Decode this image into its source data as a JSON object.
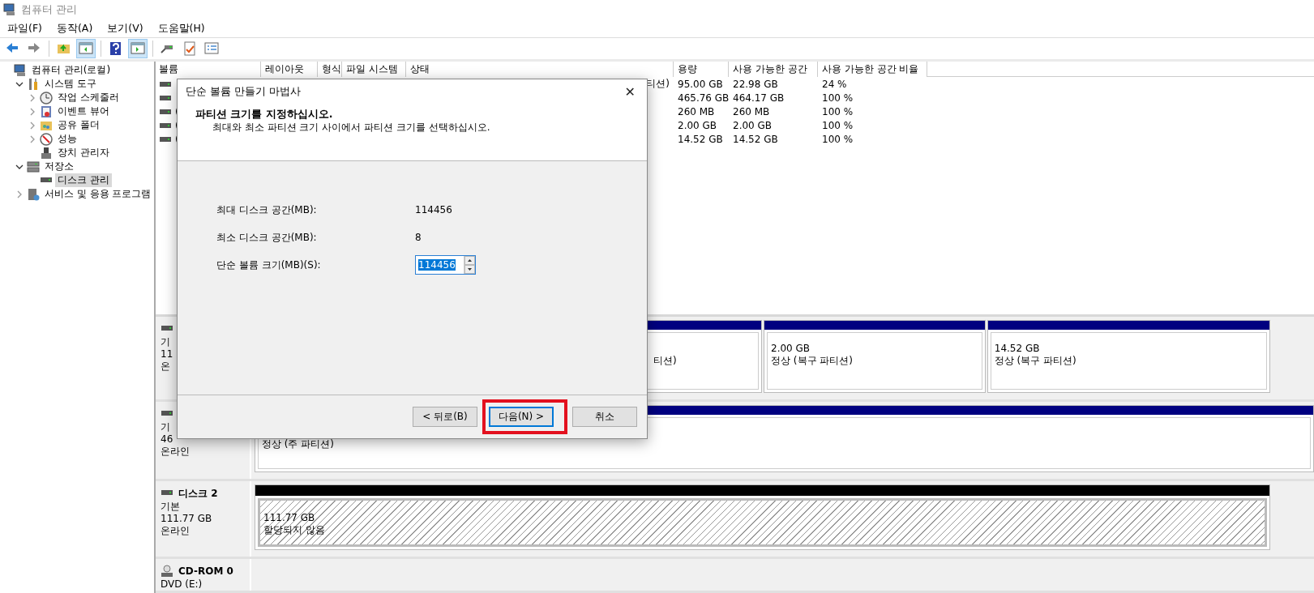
{
  "window": {
    "title": "컴퓨터 관리"
  },
  "menu": [
    "파일(F)",
    "동작(A)",
    "보기(V)",
    "도움말(H)"
  ],
  "toolbar": [
    {
      "kind": "back",
      "pressed": false
    },
    {
      "kind": "forward",
      "pressed": false
    },
    {
      "kind": "up",
      "pressed": false
    },
    {
      "kind": "tree",
      "pressed": true
    },
    {
      "kind": "help",
      "pressed": false
    },
    {
      "kind": "pane",
      "pressed": true
    },
    {
      "kind": "connect",
      "pressed": false
    },
    {
      "kind": "check",
      "pressed": false
    },
    {
      "kind": "list",
      "pressed": false
    }
  ],
  "tree": [
    {
      "label": "컴퓨터 관리(로컬)",
      "kind": "computer",
      "selected": false,
      "children": [
        {
          "label": "시스템 도구",
          "kind": "tools",
          "expanded": true,
          "selected": false,
          "children": [
            {
              "label": "작업 스케줄러",
              "kind": "clock",
              "expanded": false,
              "selected": false
            },
            {
              "label": "이벤트 뷰어",
              "kind": "events",
              "expanded": false,
              "selected": false
            },
            {
              "label": "공유 폴더",
              "kind": "share",
              "expanded": false,
              "selected": false
            },
            {
              "label": "성능",
              "kind": "perf",
              "expanded": false,
              "selected": false
            },
            {
              "label": "장치 관리자",
              "kind": "device",
              "selected": false
            }
          ]
        },
        {
          "label": "저장소",
          "kind": "storage",
          "expanded": true,
          "selected": false,
          "children": [
            {
              "label": "디스크 관리",
              "kind": "disk",
              "selected": true
            }
          ]
        },
        {
          "label": "서비스 및 응용 프로그램",
          "kind": "services",
          "expanded": false,
          "selected": false
        }
      ]
    }
  ],
  "table": {
    "columns": [
      "볼륨",
      "레이아웃",
      "형식",
      "파일 시스템",
      "상태",
      "용량",
      "사용 가능한 공간",
      "사용 가능한 공간 비율"
    ],
    "rows": [
      {
        "status": "티션)",
        "capacity": "95.00 GB",
        "free": "22.98 GB",
        "percent": "24 %"
      },
      {
        "capacity": "465.76 GB",
        "free": "464.17 GB",
        "percent": "100 %"
      },
      {
        "volume": "(",
        "capacity": "260 MB",
        "free": "260 MB",
        "percent": "100 %"
      },
      {
        "volume": "(",
        "capacity": "2.00 GB",
        "free": "2.00 GB",
        "percent": "100 %"
      },
      {
        "volume": "(",
        "capacity": "14.52 GB",
        "free": "14.52 GB",
        "percent": "100 %"
      }
    ]
  },
  "disks": [
    {
      "kind": "disk",
      "lines": [
        "기",
        "11",
        "온"
      ],
      "partitions": [
        {
          "kind": "primary",
          "lines": [
            "티션)"
          ]
        },
        {
          "kind": "primary",
          "lines": [
            "2.00 GB",
            "정상 (복구 파티션)"
          ]
        },
        {
          "kind": "primary",
          "lines": [
            "14.52 GB",
            "정상 (복구 파티션)"
          ]
        }
      ]
    },
    {
      "kind": "disk",
      "lines": [
        "기",
        "46",
        "온라인"
      ],
      "partitions": [
        {
          "kind": "primary",
          "lines": [
            "정상 (주 파티션)"
          ]
        }
      ]
    },
    {
      "kind": "disk",
      "name": "디스크 2",
      "lines": [
        "기본",
        "111.77 GB",
        "온라인"
      ],
      "partitions": [
        {
          "kind": "unallocated",
          "lines": [
            "111.77 GB",
            "할당되지 않음"
          ]
        }
      ]
    },
    {
      "kind": "cdrom",
      "name": "CD-ROM 0",
      "lines": [
        "DVD (E:)"
      ]
    }
  ],
  "dialog": {
    "title": "단순 볼륨 만들기 마법사",
    "close": "✕",
    "heading": "파티션 크기를 지정하십시오.",
    "subheading": "최대와 최소 파티션 크기 사이에서 파티션 크기를 선택하십시오.",
    "fields": [
      {
        "kind": "text",
        "label": "최대 디스크 공간(MB):",
        "value": "114456"
      },
      {
        "kind": "text",
        "label": "최소 디스크 공간(MB):",
        "value": "8"
      },
      {
        "kind": "spin",
        "label": "단순 볼륨 크기(MB)(S):",
        "value": "114456",
        "selected": true
      }
    ],
    "buttons": [
      {
        "label": "< 뒤로(B)",
        "default": false,
        "highlighted": false
      },
      {
        "label": "다음(N) >",
        "default": true,
        "highlighted": true
      },
      {
        "label": "취소",
        "default": false,
        "highlighted": false
      }
    ]
  }
}
